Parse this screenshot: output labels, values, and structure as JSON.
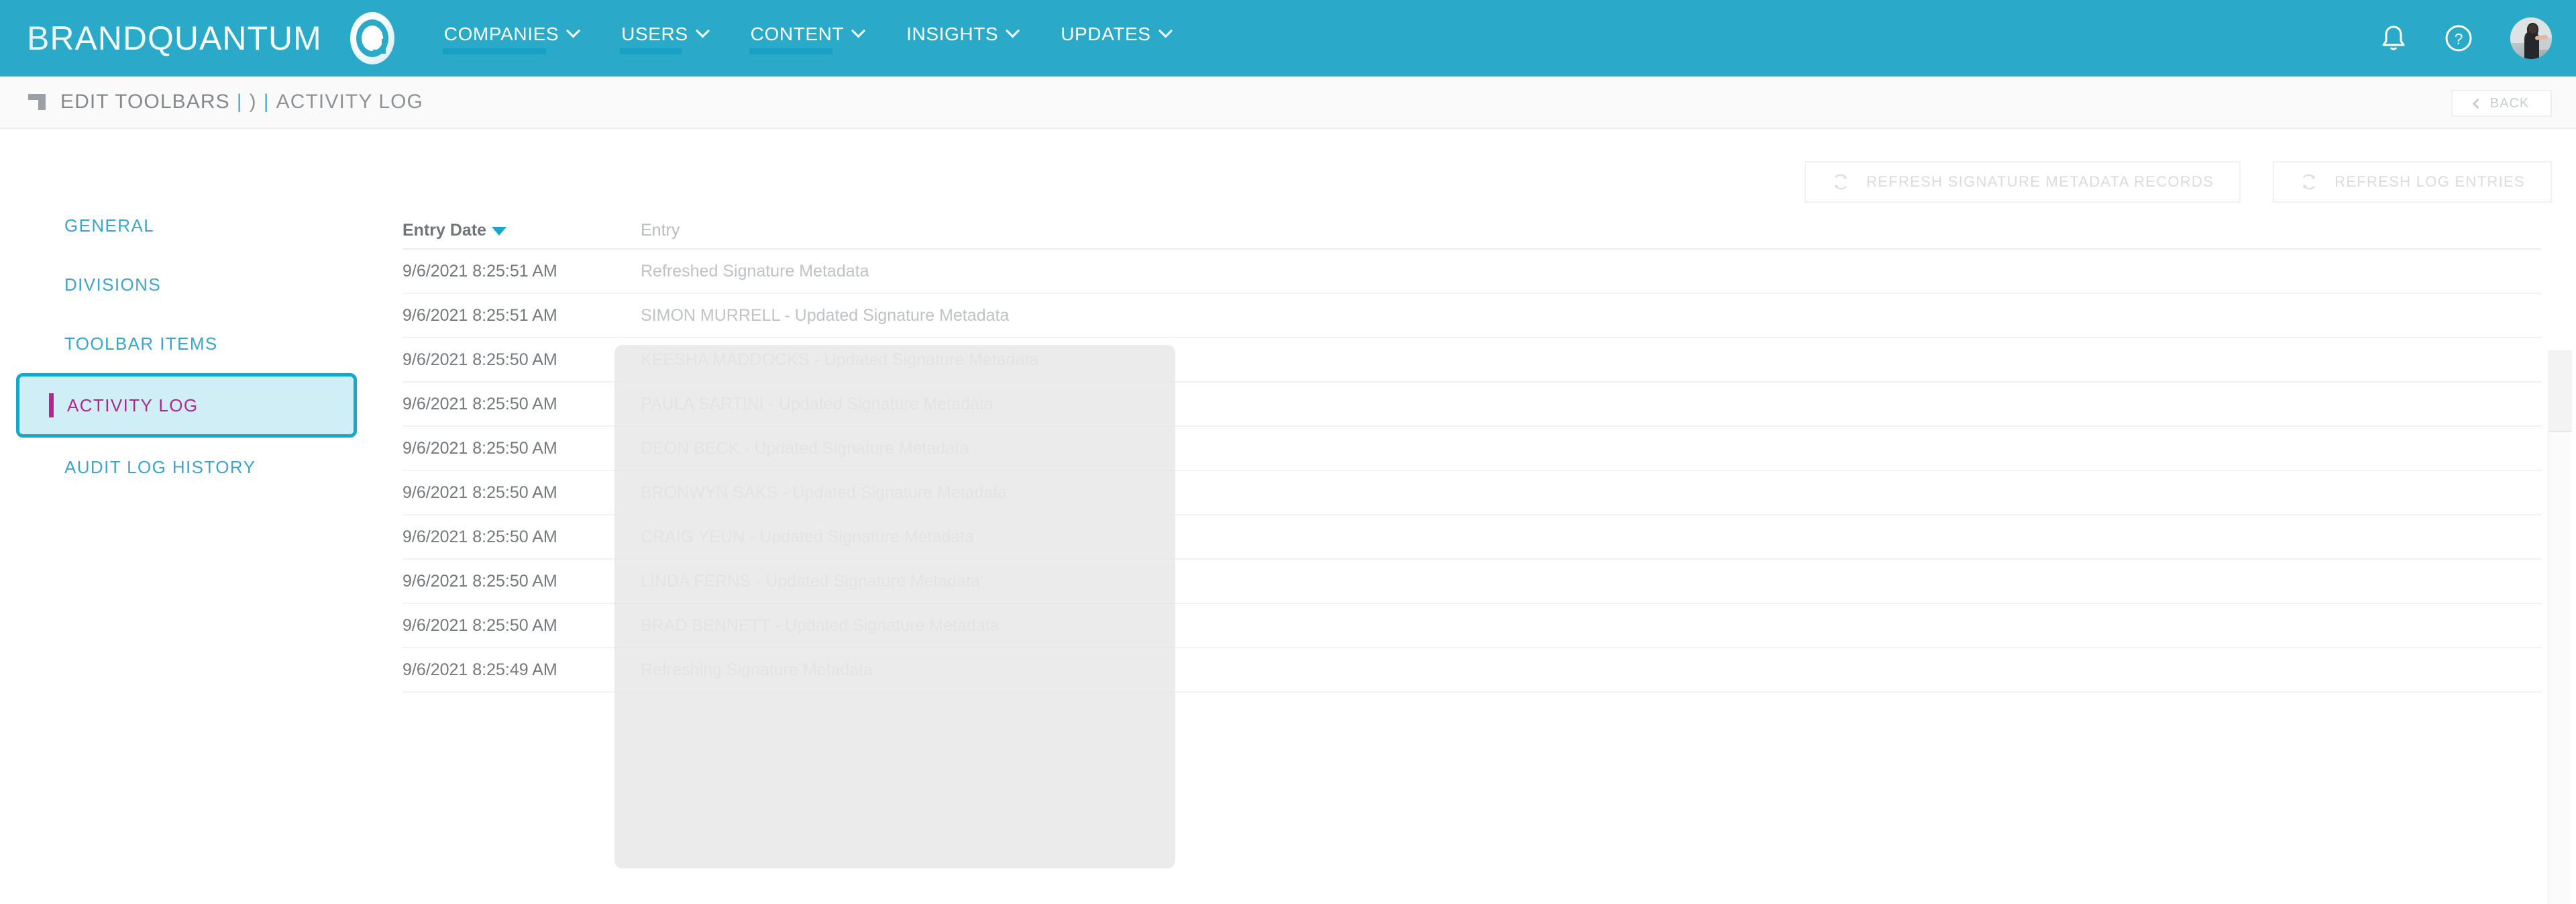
{
  "header": {
    "brand": "BRANDQUANTUM",
    "logo_icon": "quantum-q-logo-icon",
    "nav": [
      {
        "label": "COMPANIES",
        "has_caret": true,
        "underline": true,
        "width": 154
      },
      {
        "label": "USERS",
        "has_caret": true,
        "underline": true,
        "width": 92
      },
      {
        "label": "CONTENT",
        "has_caret": true,
        "underline": true,
        "width": 124
      },
      {
        "label": "INSIGHTS",
        "has_caret": true,
        "underline": false,
        "width": 0
      },
      {
        "label": "UPDATES",
        "has_caret": true,
        "underline": false,
        "width": 0
      }
    ],
    "notifications_icon": "bell-icon",
    "help_icon": "question-circle-icon",
    "avatar": "user-avatar"
  },
  "breadcrumb": {
    "icon": "flag-corner-icon",
    "parent": "EDIT TOOLBARS",
    "separator": "|",
    "middle": ")",
    "current": "ACTIVITY LOG"
  },
  "back_button": {
    "label": "BACK",
    "icon": "chevron-left-icon"
  },
  "toolbar": {
    "refresh_metadata": {
      "label": "REFRESH SIGNATURE METADATA RECORDS",
      "icon": "refresh-icon"
    },
    "refresh_log": {
      "label": "REFRESH LOG ENTRIES",
      "icon": "refresh-icon"
    }
  },
  "sidebar": {
    "items": [
      {
        "label": "GENERAL",
        "active": false
      },
      {
        "label": "DIVISIONS",
        "active": false
      },
      {
        "label": "TOOLBAR ITEMS",
        "active": false
      },
      {
        "label": "ACTIVITY LOG",
        "active": true
      },
      {
        "label": "AUDIT LOG HISTORY",
        "active": false
      }
    ],
    "active_accent_color": "#b5258e",
    "link_color": "#3aa6cd"
  },
  "table": {
    "columns": [
      {
        "key": "entry_date",
        "label": "Entry Date",
        "sorted": true,
        "sort_direction": "desc"
      },
      {
        "key": "entry",
        "label": "Entry",
        "sorted": false
      }
    ],
    "rows": [
      {
        "entry_date": "9/6/2021 8:25:51 AM",
        "entry": "Refreshed Signature Metadata"
      },
      {
        "entry_date": "9/6/2021 8:25:51 AM",
        "entry": "SIMON MURRELL - Updated Signature Metadata"
      },
      {
        "entry_date": "9/6/2021 8:25:50 AM",
        "entry": "KEESHA MADDOCKS - Updated Signature Metadata"
      },
      {
        "entry_date": "9/6/2021 8:25:50 AM",
        "entry": "PAULA SARTINI - Updated Signature Metadata"
      },
      {
        "entry_date": "9/6/2021 8:25:50 AM",
        "entry": "DEON BECK - Updated Signature Metadata"
      },
      {
        "entry_date": "9/6/2021 8:25:50 AM",
        "entry": "BRONWYN SAKS - Updated Signature Metadata"
      },
      {
        "entry_date": "9/6/2021 8:25:50 AM",
        "entry": "CRAIG YEUN - Updated Signature Metadata"
      },
      {
        "entry_date": "9/6/2021 8:25:50 AM",
        "entry": "LINDA FERNS - Updated Signature Metadata"
      },
      {
        "entry_date": "9/6/2021 8:25:50 AM",
        "entry": "BRAD BENNETT - Updated Signature Metadata"
      },
      {
        "entry_date": "9/6/2021 8:25:49 AM",
        "entry": "Refreshing Signature Metadata"
      }
    ]
  },
  "colors": {
    "brand_teal": "#2ba9c8",
    "nav_underline": "#17a0c3",
    "accent_magenta": "#b5258e",
    "active_border": "#16a8cb",
    "active_bg": "#cfeef6",
    "sort_icon": "#12a9cd"
  }
}
